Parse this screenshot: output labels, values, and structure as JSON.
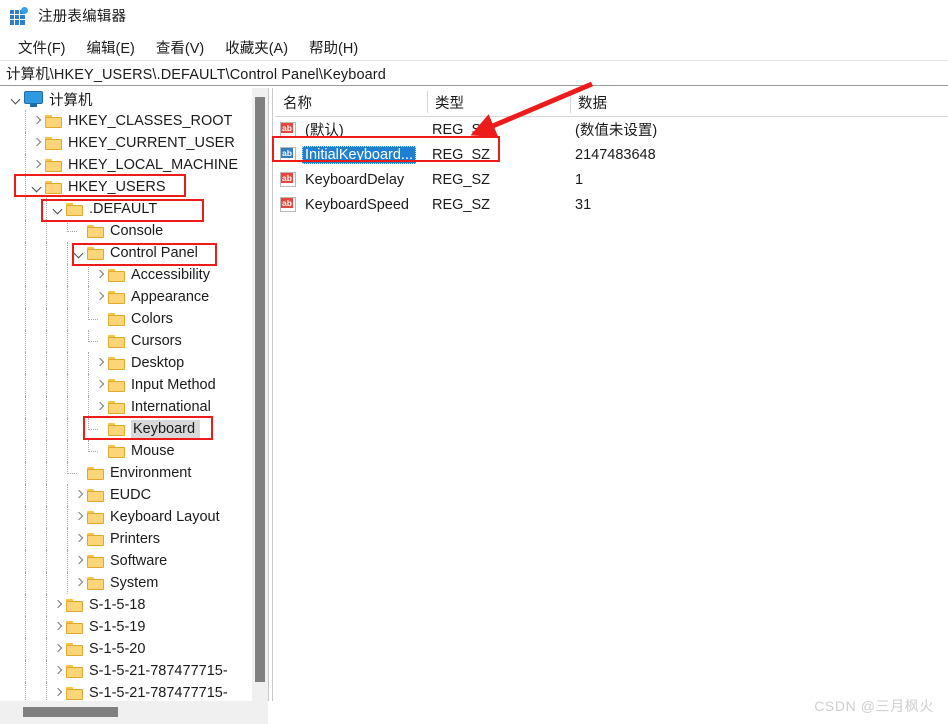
{
  "window": {
    "title": "注册表编辑器",
    "icon": "registry-editor-icon"
  },
  "menubar": {
    "items": [
      {
        "label": "文件(F)",
        "name": "menu-file"
      },
      {
        "label": "编辑(E)",
        "name": "menu-edit"
      },
      {
        "label": "查看(V)",
        "name": "menu-view"
      },
      {
        "label": "收藏夹(A)",
        "name": "menu-favorites"
      },
      {
        "label": "帮助(H)",
        "name": "menu-help"
      }
    ]
  },
  "address": {
    "path": "计算机\\HKEY_USERS\\.DEFAULT\\Control Panel\\Keyboard"
  },
  "tree": {
    "root": {
      "label": "计算机",
      "icon": "computer-monitor-icon"
    },
    "items": [
      {
        "label": "计算机",
        "depth": 0,
        "twisty": "expanded",
        "icon": "computer-monitor-icon",
        "selected": false
      },
      {
        "label": "HKEY_CLASSES_ROOT",
        "depth": 1,
        "twisty": "collapsed",
        "icon": "folder-icon",
        "selected": false
      },
      {
        "label": "HKEY_CURRENT_USER",
        "depth": 1,
        "twisty": "collapsed",
        "icon": "folder-icon",
        "selected": false
      },
      {
        "label": "HKEY_LOCAL_MACHINE",
        "depth": 1,
        "twisty": "collapsed",
        "icon": "folder-icon",
        "selected": false
      },
      {
        "label": "HKEY_USERS",
        "depth": 1,
        "twisty": "expanded",
        "icon": "folder-icon",
        "selected": false
      },
      {
        "label": ".DEFAULT",
        "depth": 2,
        "twisty": "expanded",
        "icon": "folder-icon",
        "selected": false
      },
      {
        "label": "Console",
        "depth": 3,
        "twisty": "none",
        "icon": "folder-icon",
        "selected": false
      },
      {
        "label": "Control Panel",
        "depth": 3,
        "twisty": "expanded",
        "icon": "folder-icon",
        "selected": false
      },
      {
        "label": "Accessibility",
        "depth": 4,
        "twisty": "collapsed",
        "icon": "folder-icon",
        "selected": false
      },
      {
        "label": "Appearance",
        "depth": 4,
        "twisty": "collapsed",
        "icon": "folder-icon",
        "selected": false
      },
      {
        "label": "Colors",
        "depth": 4,
        "twisty": "none",
        "icon": "folder-icon",
        "selected": false
      },
      {
        "label": "Cursors",
        "depth": 4,
        "twisty": "none",
        "icon": "folder-icon",
        "selected": false
      },
      {
        "label": "Desktop",
        "depth": 4,
        "twisty": "collapsed",
        "icon": "folder-icon",
        "selected": false
      },
      {
        "label": "Input Method",
        "depth": 4,
        "twisty": "collapsed",
        "icon": "folder-icon",
        "selected": false
      },
      {
        "label": "International",
        "depth": 4,
        "twisty": "collapsed",
        "icon": "folder-icon",
        "selected": false
      },
      {
        "label": "Keyboard",
        "depth": 4,
        "twisty": "none",
        "icon": "folder-icon",
        "selected": true
      },
      {
        "label": "Mouse",
        "depth": 4,
        "twisty": "none",
        "icon": "folder-icon",
        "selected": false
      },
      {
        "label": "Environment",
        "depth": 3,
        "twisty": "none",
        "icon": "folder-icon",
        "selected": false
      },
      {
        "label": "EUDC",
        "depth": 3,
        "twisty": "collapsed",
        "icon": "folder-icon",
        "selected": false
      },
      {
        "label": "Keyboard Layout",
        "depth": 3,
        "twisty": "collapsed",
        "icon": "folder-icon",
        "selected": false
      },
      {
        "label": "Printers",
        "depth": 3,
        "twisty": "collapsed",
        "icon": "folder-icon",
        "selected": false
      },
      {
        "label": "Software",
        "depth": 3,
        "twisty": "collapsed",
        "icon": "folder-icon",
        "selected": false
      },
      {
        "label": "System",
        "depth": 3,
        "twisty": "collapsed",
        "icon": "folder-icon",
        "selected": false
      },
      {
        "label": "S-1-5-18",
        "depth": 2,
        "twisty": "collapsed",
        "icon": "folder-icon",
        "selected": false
      },
      {
        "label": "S-1-5-19",
        "depth": 2,
        "twisty": "collapsed",
        "icon": "folder-icon",
        "selected": false
      },
      {
        "label": "S-1-5-20",
        "depth": 2,
        "twisty": "collapsed",
        "icon": "folder-icon",
        "selected": false
      },
      {
        "label": "S-1-5-21-787477715-",
        "depth": 2,
        "twisty": "collapsed",
        "icon": "folder-icon",
        "selected": false
      },
      {
        "label": "S-1-5-21-787477715-",
        "depth": 2,
        "twisty": "collapsed",
        "icon": "folder-icon",
        "selected": false
      }
    ]
  },
  "values": {
    "columns": [
      {
        "label": "名称",
        "name": "column-name"
      },
      {
        "label": "类型",
        "name": "column-type"
      },
      {
        "label": "数据",
        "name": "column-data"
      }
    ],
    "rows": [
      {
        "name": "(默认)",
        "type": "REG_SZ",
        "data": "(数值未设置)",
        "icon": "string-value-icon",
        "selected": false
      },
      {
        "name": "InitialKeyboard...",
        "type": "REG_SZ",
        "data": "2147483648",
        "icon": "string-value-icon",
        "selected": true
      },
      {
        "name": "KeyboardDelay",
        "type": "REG_SZ",
        "data": "1",
        "icon": "string-value-icon",
        "selected": false
      },
      {
        "name": "KeyboardSpeed",
        "type": "REG_SZ",
        "data": "31",
        "icon": "string-value-icon",
        "selected": false
      }
    ]
  },
  "watermark": {
    "text": "CSDN @三月枫火"
  },
  "colors": {
    "annotation": "#ee1b1b",
    "selection": "#1f7fd0",
    "tree_selection": "#d9d9d9",
    "folder": "#fcd578"
  }
}
